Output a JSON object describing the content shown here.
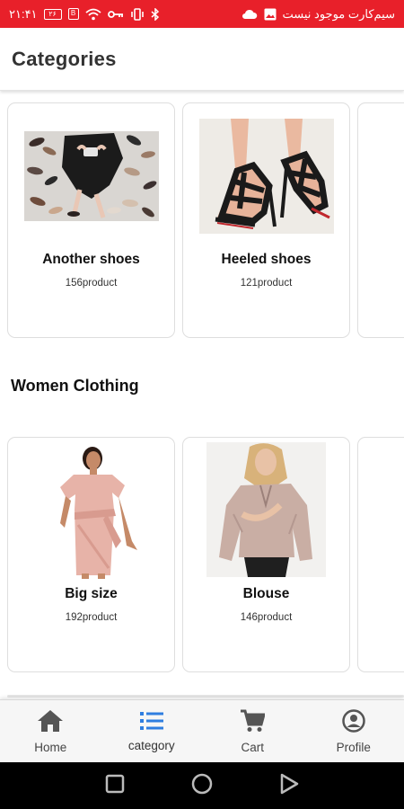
{
  "status_bar": {
    "time": "۲۱:۴۱",
    "battery": "۲۶",
    "carrier_text": "سیم‌کارت موجود نیست"
  },
  "app_bar": {
    "title": "Categories"
  },
  "rows": [
    {
      "section_title": "",
      "cards": [
        {
          "name": "Another shoes",
          "count": "156product",
          "image": "shoes-collection-photo"
        },
        {
          "name": "Heeled shoes",
          "count": "121product",
          "image": "heeled-sandals-photo"
        }
      ]
    },
    {
      "section_title": "Women Clothing",
      "cards": [
        {
          "name": "Big size",
          "count": "192product",
          "image": "pink-dress-photo"
        },
        {
          "name": "Blouse",
          "count": "146product",
          "image": "blouse-photo"
        }
      ]
    }
  ],
  "bottom_nav": {
    "items": [
      {
        "label": "Home",
        "icon": "home-icon",
        "active": false
      },
      {
        "label": "category",
        "icon": "list-icon",
        "active": true
      },
      {
        "label": "Cart",
        "icon": "cart-icon",
        "active": false
      },
      {
        "label": "Profile",
        "icon": "profile-icon",
        "active": false
      }
    ]
  },
  "colors": {
    "status_bar": "#e8202a",
    "accent": "#2f7ee0",
    "nav_icon": "#555555"
  }
}
